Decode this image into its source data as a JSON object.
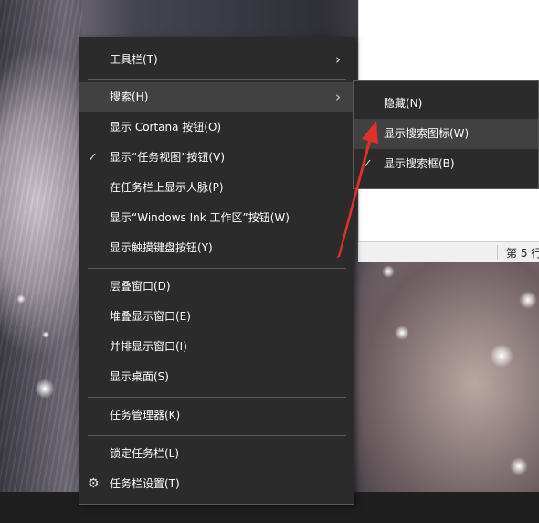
{
  "menu": {
    "items": [
      {
        "label": "工具栏(T)"
      },
      {
        "label": "搜索(H)"
      },
      {
        "label": "显示 Cortana 按钮(O)"
      },
      {
        "label": "显示“任务视图”按钮(V)"
      },
      {
        "label": "在任务栏上显示人脉(P)"
      },
      {
        "label": "显示“Windows Ink 工作区”按钮(W)"
      },
      {
        "label": "显示触摸键盘按钮(Y)"
      },
      {
        "label": "层叠窗口(D)"
      },
      {
        "label": "堆叠显示窗口(E)"
      },
      {
        "label": "并排显示窗口(I)"
      },
      {
        "label": "显示桌面(S)"
      },
      {
        "label": "任务管理器(K)"
      },
      {
        "label": "锁定任务栏(L)"
      },
      {
        "label": "任务栏设置(T)"
      }
    ],
    "chevron": "›",
    "check": "✓",
    "gear": "⚙"
  },
  "submenu": {
    "items": [
      {
        "label": "隐藏(N)"
      },
      {
        "label": "显示搜索图标(W)"
      },
      {
        "label": "显示搜索框(B)"
      }
    ]
  },
  "document": {
    "status_text": "第 5 行"
  },
  "annotation": {
    "arrow_color": "#e0302a"
  }
}
